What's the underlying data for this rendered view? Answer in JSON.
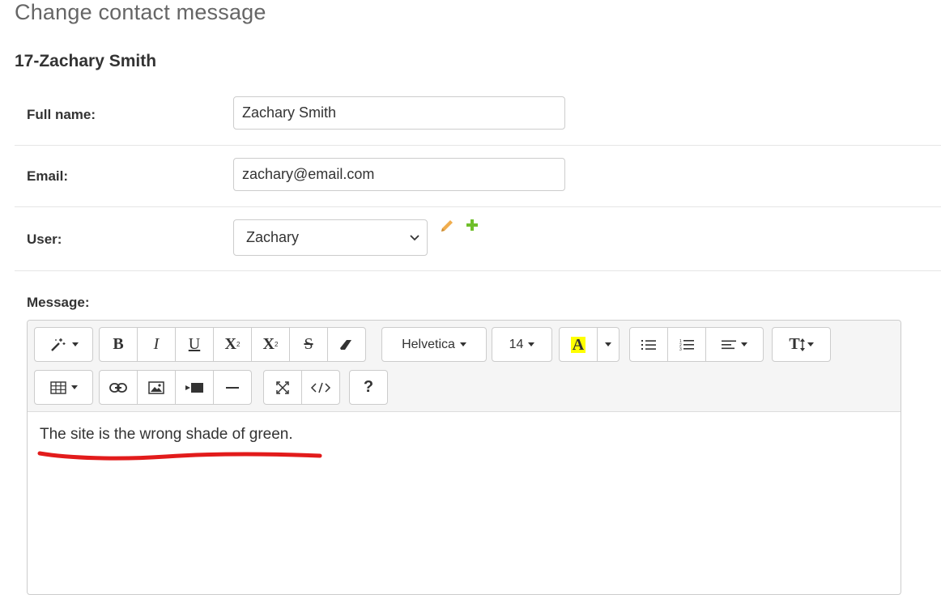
{
  "page": {
    "title": "Change contact message",
    "record_title": "17-Zachary Smith"
  },
  "form": {
    "full_name": {
      "label": "Full name:",
      "value": "Zachary Smith"
    },
    "email": {
      "label": "Email:",
      "value": "zachary@email.com"
    },
    "user": {
      "label": "User:",
      "selected": "Zachary",
      "edit_icon": "pencil-icon",
      "add_icon": "plus-icon"
    },
    "message": {
      "label": "Message:"
    }
  },
  "editor": {
    "toolbar": {
      "style_icon": "magic-wand-icon",
      "bold": "B",
      "italic": "I",
      "underline": "U",
      "superscript": "X",
      "subscript": "X",
      "strikethrough": "S",
      "eraser_icon": "eraser-icon",
      "font_family": "Helvetica",
      "font_size": "14",
      "color_letter": "A",
      "list_icons": [
        "unordered-list-icon",
        "ordered-list-icon",
        "paragraph-align-icon"
      ],
      "height_label": "T",
      "table_icon": "table-icon",
      "insert_icons": [
        "link-icon",
        "picture-icon",
        "video-icon",
        "horizontal-rule-icon"
      ],
      "view_icons": [
        "fullscreen-icon",
        "code-view-icon"
      ],
      "help_label": "?"
    },
    "content": "The site is the wrong shade of green."
  },
  "colors": {
    "highlight_yellow": "#ffff00",
    "pencil_orange": "#f0ad4e",
    "plus_green": "#70bf2b",
    "annotation_red": "#e21b1b"
  }
}
